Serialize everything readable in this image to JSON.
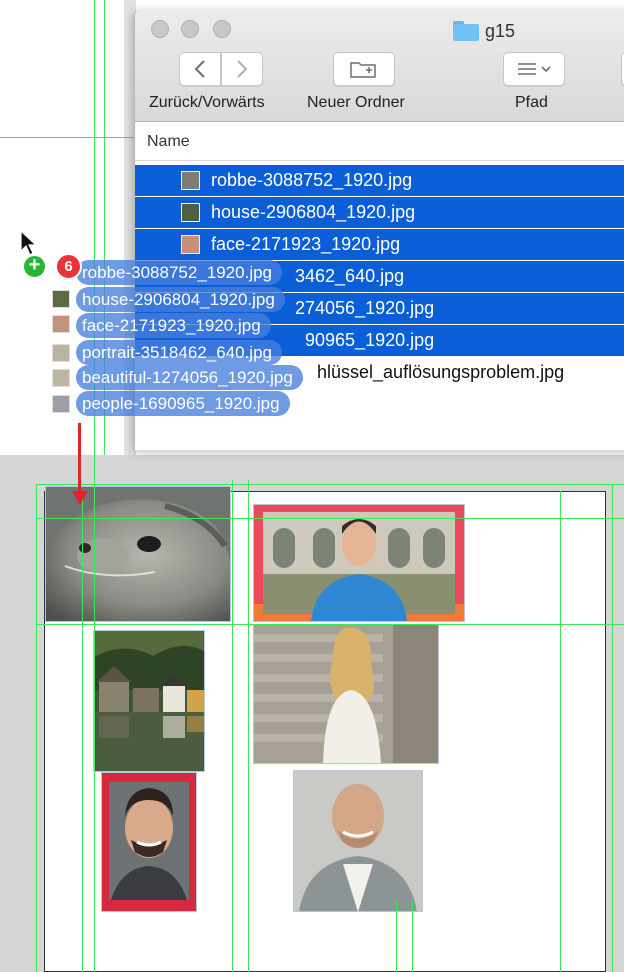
{
  "finder": {
    "title": "g15",
    "toolbar": {
      "back_forward_label": "Zurück/Vorwärts",
      "new_folder_label": "Neuer Ordner",
      "path_label": "Pfad"
    },
    "column_header": "Name",
    "files": [
      {
        "name": "robbe-3088752_1920.jpg",
        "selected": true
      },
      {
        "name": "house-2906804_1920.jpg",
        "selected": true
      },
      {
        "name": "face-2171923_1920.jpg",
        "selected": true
      },
      {
        "name": "3462_640.jpg",
        "selected": true
      },
      {
        "name": "274056_1920.jpg",
        "selected": true
      },
      {
        "name": "90965_1920.jpg",
        "selected": true
      },
      {
        "name": "hlüssel_auflösungsproblem.jpg",
        "selected": false
      }
    ]
  },
  "drag": {
    "count": "6",
    "plus": "+",
    "items": [
      "robbe-3088752_1920.jpg",
      "house-2906804_1920.jpg",
      "face-2171923_1920.jpg",
      "portrait-3518462_640.jpg",
      "beautiful-1274056_1920.jpg",
      "people-1690965_1920.jpg"
    ]
  },
  "colors": {
    "selection": "#0a5fd8",
    "guide": "#3ee65a",
    "badge_red": "#e8353b",
    "badge_green": "#27b536",
    "arrow": "#e1232c"
  },
  "icons": {
    "cursor": "arrow-cursor-icon",
    "folder": "folder-icon",
    "new_folder": "new-folder-icon",
    "path": "path-list-icon"
  }
}
